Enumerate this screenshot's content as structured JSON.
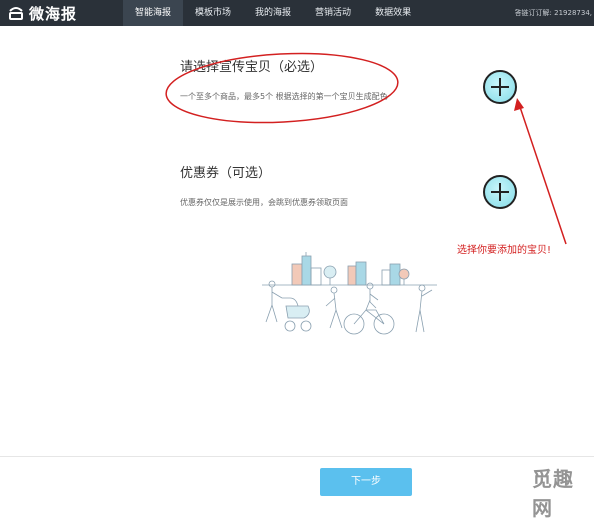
{
  "brand": {
    "name": "微海报",
    "icon": "logo-icon"
  },
  "nav": {
    "items": [
      {
        "label": "智能海报",
        "active": true
      },
      {
        "label": "模板市场",
        "active": false
      },
      {
        "label": "我的海报",
        "active": false
      },
      {
        "label": "营销活动",
        "active": false
      },
      {
        "label": "数据效果",
        "active": false
      }
    ]
  },
  "account": {
    "text": "答链订订解: 21928734,"
  },
  "sections": {
    "product": {
      "title": "请选择宣传宝贝（必选）",
      "desc": "一个至多个商品，最多5个 根据选择的第一个宝贝生成配色",
      "add_icon": "plus-icon"
    },
    "coupon": {
      "title": "优惠券（可选）",
      "desc": "优惠券仅仅是展示使用，会跳到优惠券领取页面",
      "add_icon": "plus-icon"
    }
  },
  "annotation": {
    "text": "选择你要添加的宝贝!",
    "color": "#d32020"
  },
  "footer": {
    "next_label": "下一步"
  },
  "watermark": {
    "text": "觅趣网"
  },
  "colors": {
    "topbar": "#2a3139",
    "accent": "#5bc0ee",
    "add_button": "#9fe6ef"
  }
}
